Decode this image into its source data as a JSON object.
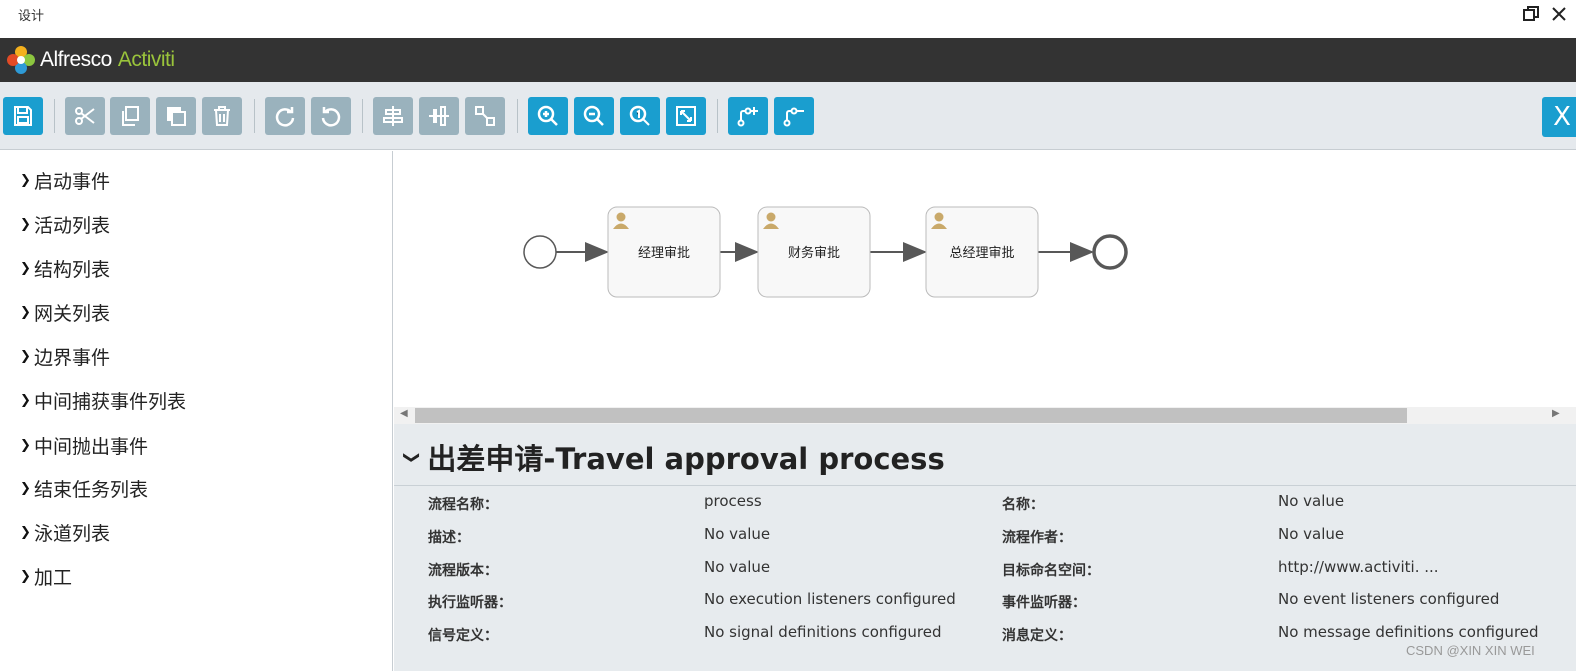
{
  "window": {
    "title": "设计",
    "restore_icon": "restore-icon",
    "close_icon": "close-icon"
  },
  "brand": {
    "part1": "Alfresco",
    "part2": "Activiti",
    "logo_icon": "alfresco-logo-icon"
  },
  "toolbar": {
    "buttons": [
      "save",
      "cut",
      "copy",
      "paste",
      "delete",
      "redo",
      "undo",
      "align-horizontal",
      "align-vertical",
      "same-size",
      "zoom-in",
      "zoom-out",
      "zoom-actual",
      "zoom-fit",
      "add-bendpoint",
      "remove-bendpoint"
    ],
    "close_label": "X"
  },
  "palette": {
    "items": [
      "启动事件",
      "活动列表",
      "结构列表",
      "网关列表",
      "边界事件",
      "中间捕获事件列表",
      "中间抛出事件",
      "结束任务列表",
      "泳道列表",
      "加工"
    ]
  },
  "diagram": {
    "tasks": [
      "经理审批",
      "财务审批",
      "总经理审批"
    ],
    "user_icon": "user-icon"
  },
  "properties": {
    "title": "出差申请-Travel approval process",
    "rows": [
      {
        "l1": "流程名称：",
        "v1": "process",
        "l2": "名称：",
        "v2": "No value"
      },
      {
        "l1": "描述：",
        "v1": "No value",
        "l2": "流程作者：",
        "v2": "No value"
      },
      {
        "l1": "流程版本：",
        "v1": "No value",
        "l2": "目标命名空间：",
        "v2": "http://www.activiti. ..."
      },
      {
        "l1": "执行监听器：",
        "v1": "No execution listeners configured",
        "l2": "事件监听器：",
        "v2": "No event listeners configured"
      },
      {
        "l1": "信号定义：",
        "v1": "No signal definitions configured",
        "l2": "消息定义：",
        "v2": "No message definitions configured"
      }
    ]
  },
  "watermark": "CSDN @XIN XIN WEI",
  "colors": {
    "toolbar_blue": "#1a9ecf",
    "toolbar_gray": "#9ab2bd",
    "brand_green": "#9ac43b",
    "header_dark": "#333333"
  }
}
